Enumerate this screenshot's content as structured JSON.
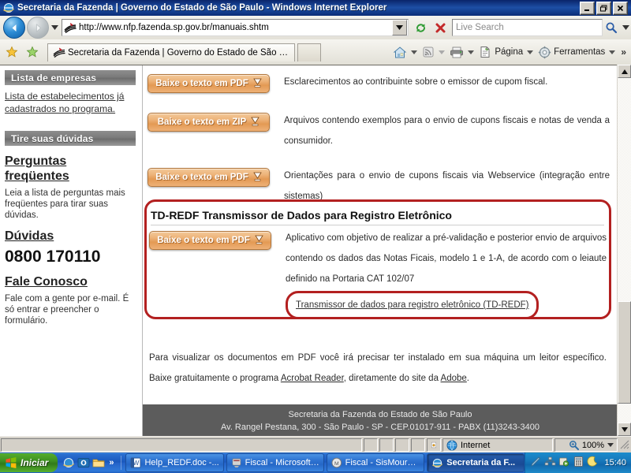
{
  "window": {
    "title": "Secretaria da Fazenda | Governo do Estado de São Paulo - Windows Internet Explorer",
    "minimize_label": "_",
    "restore_label": "❐",
    "close_label": "✕"
  },
  "navbar": {
    "back_name": "back-button",
    "forward_name": "forward-button",
    "url": "http://www.nfp.fazenda.sp.gov.br/manuais.shtm",
    "refresh_label": "refresh-icon",
    "stop_label": "stop-icon",
    "search_placeholder": "Live Search",
    "search_value": ""
  },
  "commandbar": {
    "tab_label": "Secretaria da Fazenda | Governo do Estado de São P...",
    "home_label": "home-icon",
    "feeds_label": "feeds-icon",
    "print_label": "print-icon",
    "page_label": "Página",
    "tools_label": "Ferramentas",
    "overflow_label": "»"
  },
  "sidebar": {
    "sections": [
      {
        "header": "Lista de empresas",
        "link": "Lista de estabelecimentos já cadastrados no programa."
      },
      {
        "header": "Tire suas dúvidas",
        "heading1": "Perguntas freqüentes",
        "paragraph1": "Leia a lista de perguntas mais freqüentes para tirar suas dúvidas.",
        "heading2": "Dúvidas",
        "phone": "0800 170110",
        "heading3": "Fale Conosco",
        "paragraph2": "Fale com a gente por e-mail. É só entrar e preencher o formulário."
      }
    ]
  },
  "main": {
    "rows": [
      {
        "button": "Baixe o texto em PDF",
        "text": "Esclarecimentos ao contribuinte sobre o emissor de cupom fiscal."
      },
      {
        "button": "Baixe o texto em ZIP",
        "text": "Arquivos contendo exemplos para o envio de cupons fiscais e notas de venda a consumidor."
      },
      {
        "button": "Baixe o texto em PDF",
        "text": "Orientações para o envio de cupons fiscais via Webservice (integração entre sistemas)"
      }
    ],
    "highlight": {
      "title": "TD-REDF Transmissor de Dados para Registro Eletrônico",
      "button": "Baixe o texto em PDF",
      "text": "Aplicativo com objetivo de realizar a pré-validação e posterior envio de arquivos contendo os dados das Notas Ficais, modelo 1 e 1-A, de acordo com o leiaute definido na Portaria CAT 102/07",
      "link": "Transmissor de dados para registro eletrônico (TD-REDF)",
      "border_color": "#b32020"
    },
    "note_part1": "Para visualizar os documentos em PDF você irá precisar ter instalado em sua máquina um leitor específico. Baixe gratuitamente o programa ",
    "note_link1": "Acrobat Reader",
    "note_part2": ", diretamente do site da ",
    "note_link2": "Adobe",
    "note_part3": ".",
    "footer_line1": "Secretaria da Fazenda do Estado de São Paulo",
    "footer_line2": "Av. Rangel Pestana, 300 - São Paulo - SP - CEP.01017-911 - PABX (11)3243-3400"
  },
  "statusbar": {
    "message": "",
    "zone": "Internet",
    "zoom": "100%"
  },
  "taskbar": {
    "start": "Iniciar",
    "quicklaunch_chevron": "»",
    "items": [
      {
        "label": "Help_REDF.doc -...",
        "icon": "word-icon",
        "active": false
      },
      {
        "label": "Fiscal - Microsoft ...",
        "icon": "access-icon",
        "active": false
      },
      {
        "label": "Fiscal - SisMoura ...",
        "icon": "app-icon",
        "active": false
      },
      {
        "label": "Secretaria da F...",
        "icon": "ie-icon",
        "active": true
      }
    ],
    "clock": "15:40"
  }
}
